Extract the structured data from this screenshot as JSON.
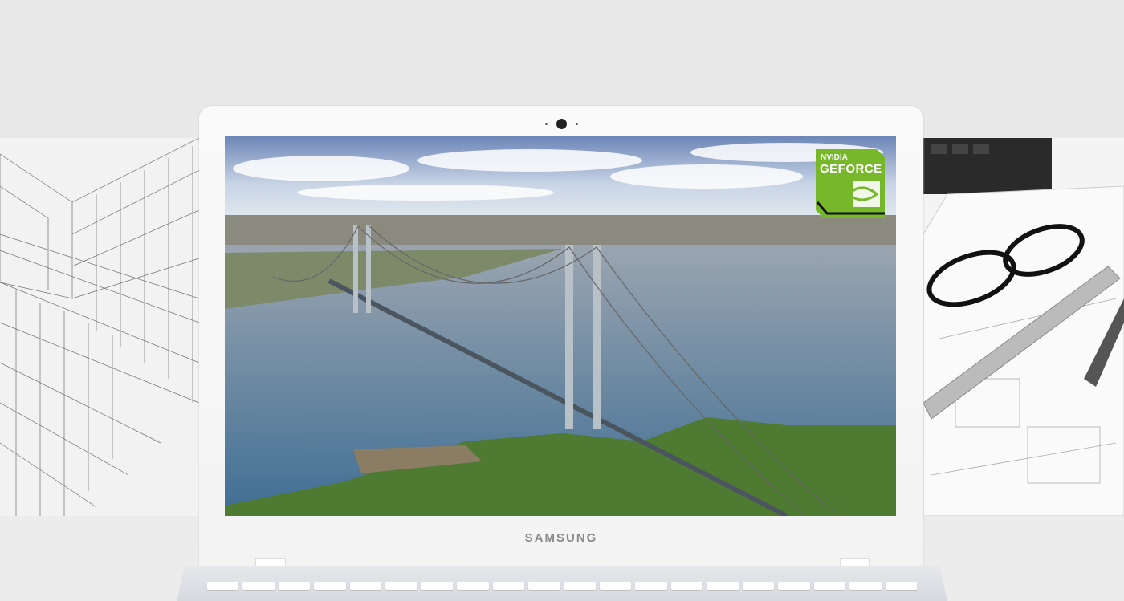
{
  "laptop": {
    "brand": "SAMSUNG"
  },
  "badge": {
    "line1": "NVIDIA",
    "line2": "GEFORCE",
    "color": "#76b82a"
  },
  "scene": "suspension-bridge-aerial"
}
